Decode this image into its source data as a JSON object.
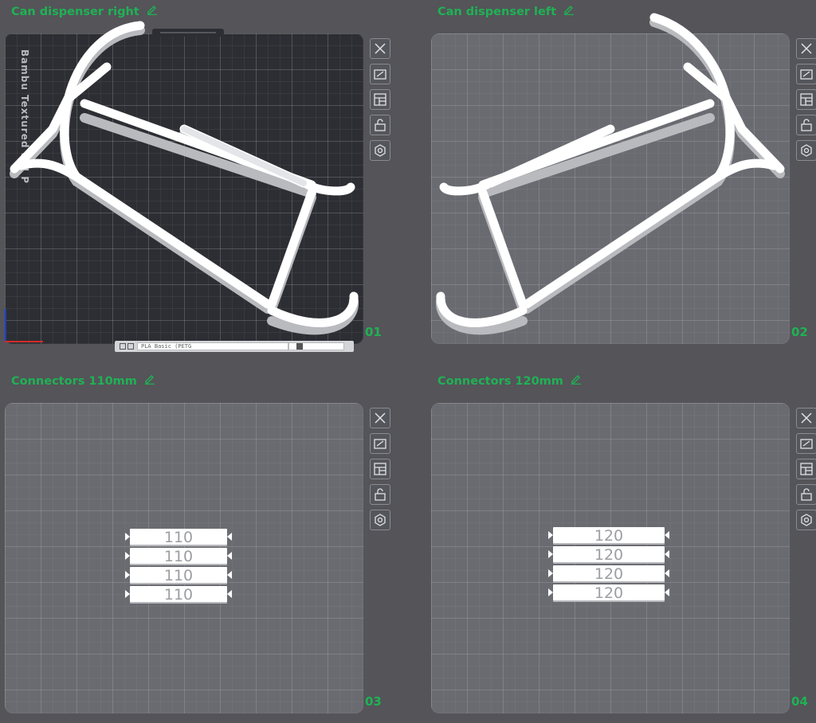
{
  "plates": [
    {
      "title": "Can dispenser right",
      "number": "01",
      "selected": true,
      "brand_text": "Bambu Textured PEI P",
      "bottom_bar": {
        "slot_text": "PLA Basic (PETG",
        "slot2_text": ""
      }
    },
    {
      "title": "Can dispenser left",
      "number": "02",
      "selected": false
    },
    {
      "title": "Connectors 110mm",
      "number": "03",
      "selected": false,
      "strip_labels": [
        "110",
        "110",
        "110",
        "110"
      ]
    },
    {
      "title": "Connectors 120mm",
      "number": "04",
      "selected": false,
      "strip_labels": [
        "120",
        "120",
        "120",
        "120"
      ]
    }
  ],
  "tools": [
    {
      "icon": "close-icon"
    },
    {
      "icon": "auto-orient-icon"
    },
    {
      "icon": "arrange-icon"
    },
    {
      "icon": "lock-icon"
    },
    {
      "icon": "settings-icon"
    }
  ],
  "colors": {
    "background": "#545459",
    "accent_green": "#1fb254",
    "plate_light": "#6a6b71",
    "plate_dark": "#2d2e33",
    "model_white": "#ffffff"
  }
}
